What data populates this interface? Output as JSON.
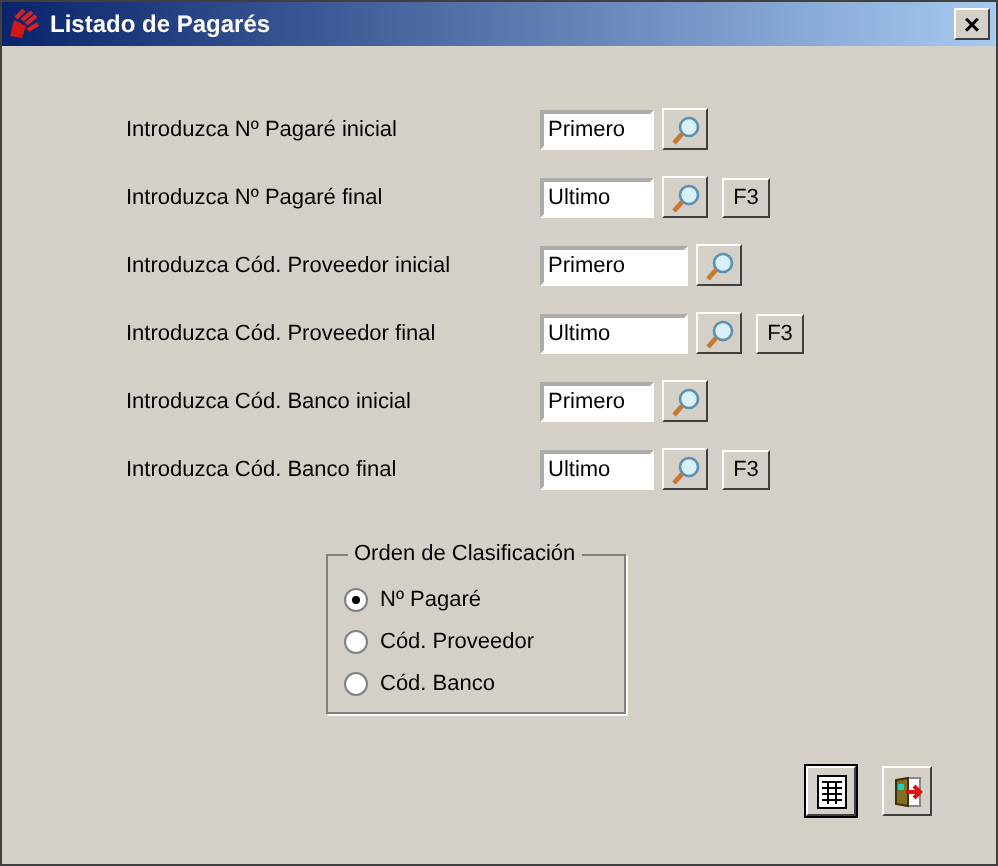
{
  "window": {
    "title": "Listado de Pagarés",
    "close": "×"
  },
  "rows": [
    {
      "label": "Introduzca Nº Pagaré inicial",
      "value": "Primero"
    },
    {
      "label": "Introduzca Nº Pagaré final",
      "value": "Ultimo",
      "key": "F3"
    },
    {
      "label": "Introduzca Cód. Proveedor inicial",
      "value": "Primero"
    },
    {
      "label": "Introduzca Cód. Proveedor final",
      "value": "Ultimo",
      "key": "F3"
    },
    {
      "label": "Introduzca Cód. Banco inicial",
      "value": "Primero"
    },
    {
      "label": "Introduzca Cód. Banco final",
      "value": "Ultimo",
      "key": "F3"
    }
  ],
  "sort_order": {
    "title": "Orden de Clasificación",
    "options": [
      {
        "label": "Nº Pagaré",
        "selected": true
      },
      {
        "label": "Cód. Proveedor",
        "selected": false
      },
      {
        "label": "Cód. Banco",
        "selected": false
      }
    ]
  }
}
